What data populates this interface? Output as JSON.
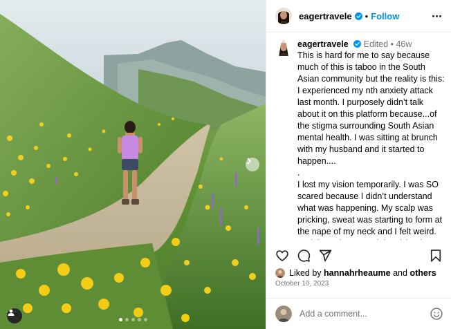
{
  "post": {
    "username": "eagertravele",
    "follow_label": "Follow",
    "separator": "•",
    "edited_label": "Edited",
    "time_ago": "46w",
    "caption": "This is hard for me to say because much of this is taboo in the South Asian community but the reality is this: I experienced my nth anxiety attack last month. I purposely didn’t talk about it on this platform because...of the stigma surrounding South Asian mental health. I was sitting at brunch with my husband and it started to happen....\n.\nI lost my vision temporarily. I was SO scared because I didn’t understand what was happening. My scalp was pricking, sweat was starting to form at the nape of my neck and I felt weird. And then I knew. And the vision loss omg!???\n.\nIn the South Asian culture we are influenced by a “collectivist culture” and",
    "likes_prefix": "Liked by",
    "liked_by_user": "hannahrheaume",
    "likes_conjunction": "and",
    "likes_others": "others",
    "date": "October 10, 2023",
    "comment_placeholder": "Add a comment..."
  },
  "carousel": {
    "slide_count": 5,
    "active_index": 0
  },
  "icons": {
    "verified": "verified-badge-icon",
    "more": "more-options-icon",
    "like": "heart-icon",
    "comment": "comment-icon",
    "share": "share-icon",
    "save": "bookmark-icon",
    "emoji": "emoji-icon",
    "next": "chevron-right-icon",
    "tags": "person-tag-icon"
  },
  "colors": {
    "accent": "#0095f6",
    "muted": "#737373",
    "border": "#efefef"
  }
}
